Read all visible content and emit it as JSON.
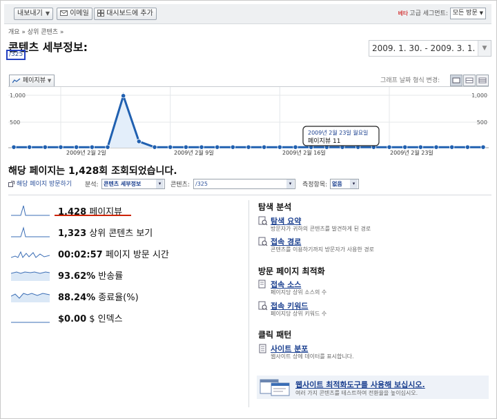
{
  "toolbar": {
    "export_label": "내보내기",
    "email_label": "이메일",
    "dashboard_label": "대시보드에 추가",
    "beta_label": "베타",
    "segment_label": "고급 세그먼트:",
    "segment_value": "모든 방문"
  },
  "breadcrumb": "개요 » 상위 콘텐츠 »",
  "page": {
    "title": "콘텐츠 세부정보:",
    "path": "/325",
    "date_range": "2009. 1. 30. - 2009. 3. 1."
  },
  "graph": {
    "tab_label": "페이지뷰",
    "option_label": "그래프 날짜 형식 변경:"
  },
  "chart_data": {
    "type": "line",
    "series": [
      {
        "name": "페이지뷰",
        "values": [
          11,
          11,
          11,
          11,
          11,
          11,
          11,
          990,
          120,
          11,
          11,
          11,
          11,
          11,
          11,
          11,
          11,
          11,
          11,
          11,
          11,
          11,
          11,
          11,
          11,
          11,
          11,
          11,
          11,
          11,
          11
        ]
      }
    ],
    "ylim": [
      0,
      1000
    ],
    "y_ticks": [
      "1,000",
      "500"
    ],
    "x_tick_labels": [
      "2009년 2월 2일",
      "2009년 2월 9일",
      "2009년 2월 16일",
      "2009년 2월 23일"
    ],
    "tooltip": {
      "date": "2009년 2월 23일 월요일",
      "text": "페이지뷰 11"
    }
  },
  "summary": "해당 페이지는 1,428회 조회되었습니다.",
  "controls": {
    "visit_link": "해당 페이지 방문하기",
    "analysis_label": "분석:",
    "analysis_value": "콘텐츠 세부정보",
    "content_label": "콘텐츠:",
    "content_value": "/325",
    "dimension_label": "측정항목:",
    "dimension_value": "없음"
  },
  "metrics": [
    {
      "value": "1,428",
      "label": "페이지뷰"
    },
    {
      "value": "1,323",
      "label": "상위 콘텐츠 보기"
    },
    {
      "value": "00:02:57",
      "label": "페이지 방문 시간"
    },
    {
      "value": "93.62%",
      "label": "반송률"
    },
    {
      "value": "88.24%",
      "label": "종료율(%)"
    },
    {
      "value": "$0.00",
      "label": "$ 인덱스"
    }
  ],
  "navigation": {
    "title": "탐색 분석",
    "items": [
      {
        "link": "탐색 요약",
        "desc": "방문자가 귀하의 콘텐츠를 발견하게 된 경로"
      },
      {
        "link": "접속 경로",
        "desc": "콘텐츠를 이용하기까지 방문자가 사용한 경로"
      }
    ]
  },
  "landing": {
    "title": "방문 페이지 최적화",
    "items": [
      {
        "link": "접속 소스",
        "desc": "페이지당 상위 소스의 수"
      },
      {
        "link": "접속 키워드",
        "desc": "페이지당 상위 키워드 수"
      }
    ]
  },
  "click": {
    "title": "클릭 패턴",
    "items": [
      {
        "link": "사이트 분포",
        "desc": "웹사이트 상에 데이터를 표시합니다."
      }
    ]
  },
  "promo": {
    "link": "웹사이트 최적화도구를 사용해 보십시오.",
    "desc": "여러 가지 콘텐츠를 테스트하여 전환율을 높이십시오."
  }
}
